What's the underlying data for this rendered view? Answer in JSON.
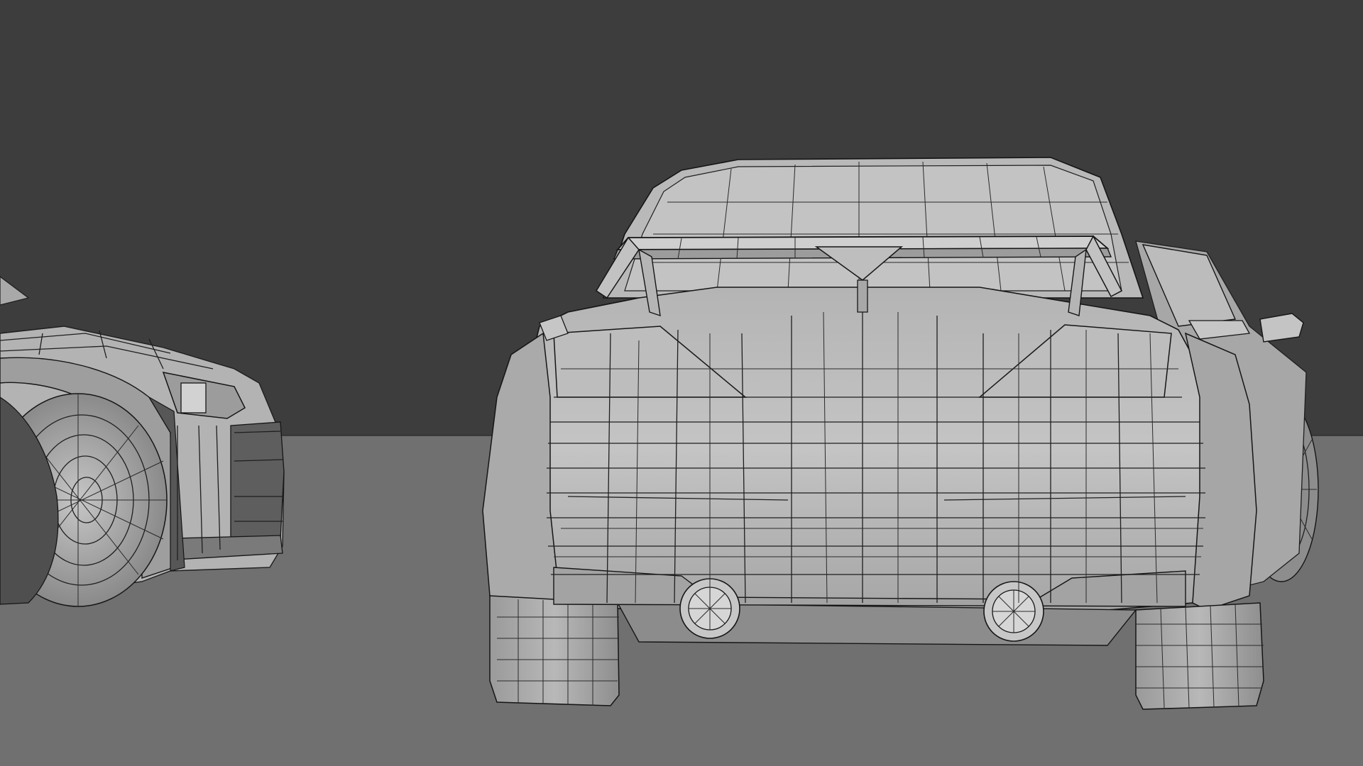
{
  "viewport": {
    "shading": "solid-wireframe",
    "colors": {
      "background": "#3d3d3d",
      "floor": "#707070",
      "mesh_light": "#bcbcbc",
      "mesh_mid": "#a3a3a3",
      "mesh_dark": "#5a5a5a",
      "wire": "#1e1e1e"
    }
  },
  "scene": {
    "objects": [
      {
        "name": "car-rear-model",
        "view": "rear"
      },
      {
        "name": "car-front-model",
        "view": "front-three-quarter",
        "partially_visible": true
      }
    ]
  }
}
